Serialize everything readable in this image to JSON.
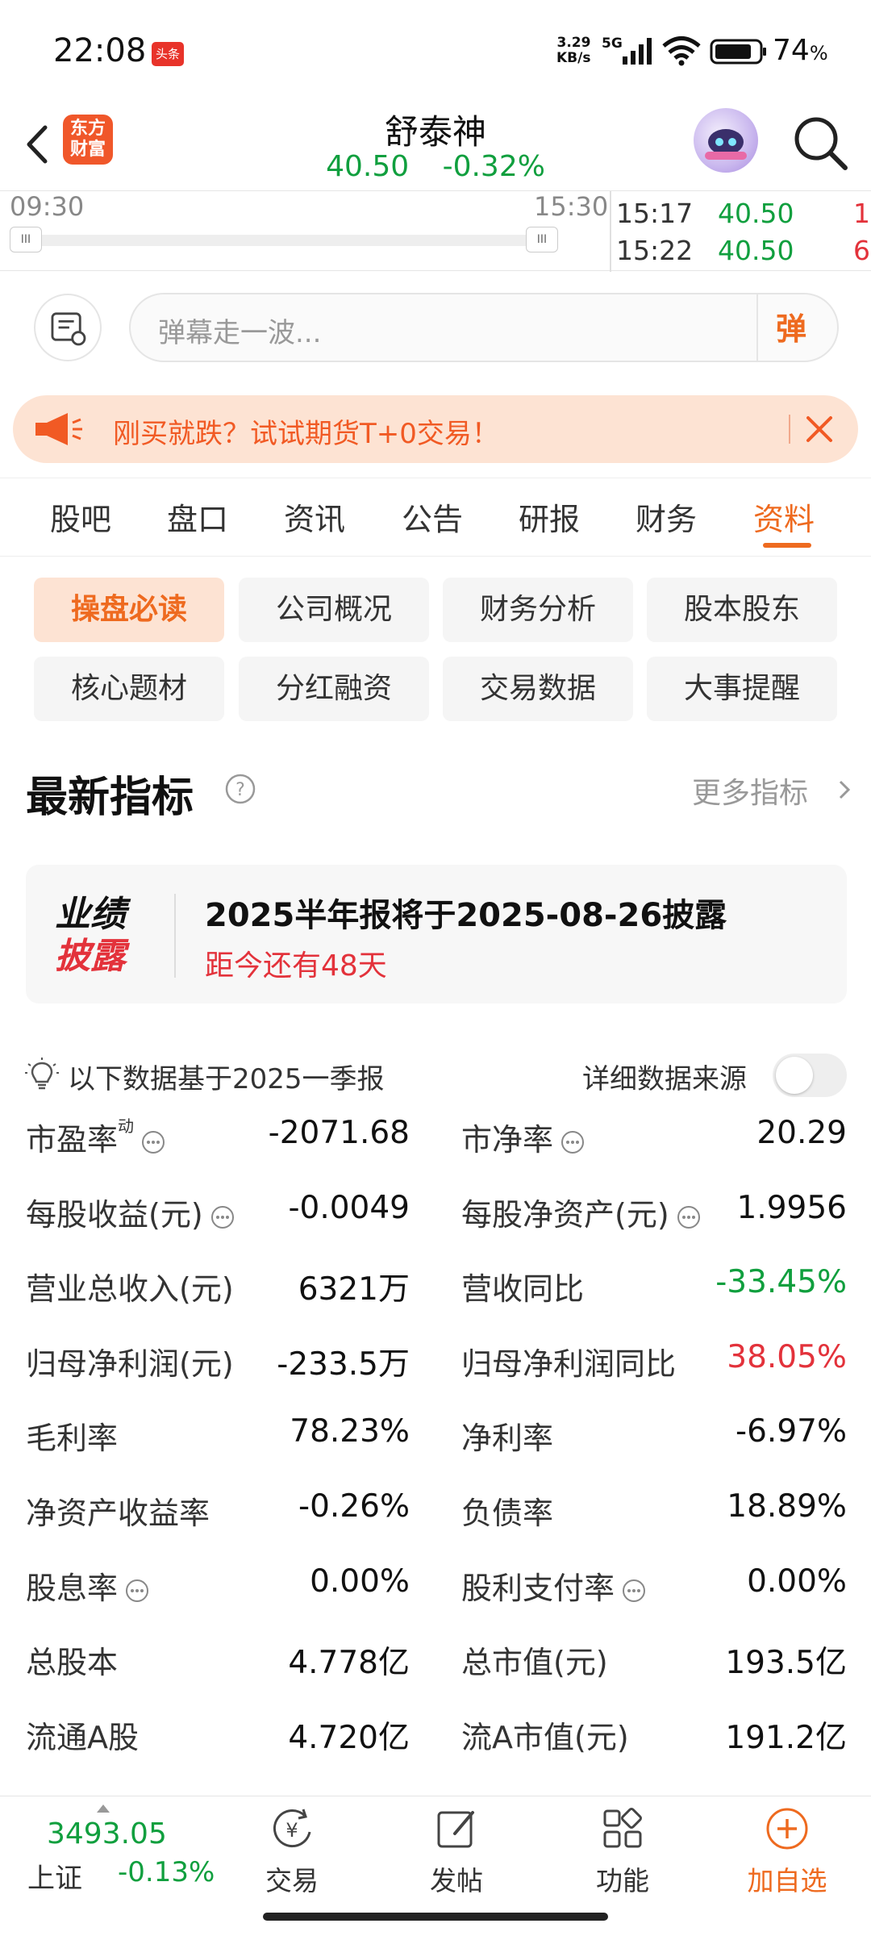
{
  "status_bar": {
    "time": "22:08",
    "app_badge": "头条",
    "net_speed_value": "3.29",
    "net_speed_unit": "KB/s",
    "network": "5G",
    "battery": "74",
    "battery_unit": "%"
  },
  "header": {
    "logo_line1": "东方",
    "logo_line2": "财富",
    "stock_name": "舒泰神",
    "price": "40.50",
    "change_pct": "-0.32%"
  },
  "strip": {
    "time_start": "09:30",
    "time_end": "15:30",
    "handle_glyph": "III",
    "ticks": [
      {
        "time": "15:17",
        "price": "40.50",
        "vol": "1"
      },
      {
        "time": "15:22",
        "price": "40.50",
        "vol": "6"
      }
    ]
  },
  "danmu": {
    "placeholder": "弹幕走一波...",
    "button": "弹"
  },
  "promo": {
    "text": "刚买就跌？试试期货T+0交易！"
  },
  "tabs": [
    "股吧",
    "盘口",
    "资讯",
    "公告",
    "研报",
    "财务",
    "资料"
  ],
  "active_tab_index": 6,
  "chips": [
    [
      "操盘必读",
      "公司概况",
      "财务分析",
      "股本股东"
    ],
    [
      "核心题材",
      "分红融资",
      "交易数据",
      "大事提醒"
    ]
  ],
  "section": {
    "title": "最新指标",
    "more": "更多指标"
  },
  "disclosure": {
    "badge_line1": "业绩",
    "badge_line2": "披露",
    "title": "2025半年报将于2025-08-26披露",
    "countdown": "距今还有48天"
  },
  "basis": {
    "text": "以下数据基于2025一季报",
    "source_label": "详细数据来源",
    "source_on": false
  },
  "metrics": [
    {
      "left_label": "市盈率",
      "left_sup": "动",
      "left_info": true,
      "left_value": "-2071.68",
      "right_label": "市净率",
      "right_info": true,
      "right_value": "20.29"
    },
    {
      "left_label": "每股收益(元)",
      "left_info": true,
      "left_value": "-0.0049",
      "right_label": "每股净资产(元)",
      "right_info": true,
      "right_value": "1.9956"
    },
    {
      "left_label": "营业总收入(元)",
      "left_value": "6321万",
      "right_label": "营收同比",
      "right_value": "-33.45%",
      "right_color": "green"
    },
    {
      "left_label": "归母净利润(元)",
      "left_value": "-233.5万",
      "right_label": "归母净利润同比",
      "right_value": "38.05%",
      "right_color": "red"
    },
    {
      "left_label": "毛利率",
      "left_value": "78.23%",
      "right_label": "净利率",
      "right_value": "-6.97%"
    },
    {
      "left_label": "净资产收益率",
      "left_value": "-0.26%",
      "right_label": "负债率",
      "right_value": "18.89%"
    },
    {
      "left_label": "股息率",
      "left_info": true,
      "left_value": "0.00%",
      "right_label": "股利支付率",
      "right_info": true,
      "right_value": "0.00%"
    },
    {
      "left_label": "总股本",
      "left_value": "4.778亿",
      "right_label": "总市值(元)",
      "right_value": "193.5亿"
    },
    {
      "left_label": "流通A股",
      "left_value": "4.720亿",
      "right_label": "流A市值(元)",
      "right_value": "191.2亿"
    }
  ],
  "bottom": {
    "index_value": "3493.05",
    "index_name": "上证",
    "index_change": "-0.13%",
    "nav": [
      {
        "label": "交易",
        "icon": "trade-icon"
      },
      {
        "label": "发帖",
        "icon": "post-icon"
      },
      {
        "label": "功能",
        "icon": "grid-icon"
      },
      {
        "label": "加自选",
        "icon": "add-circle-icon"
      }
    ]
  },
  "colors": {
    "accent": "#ee6a1f",
    "up": "#e3323b",
    "down": "#109f3e"
  }
}
